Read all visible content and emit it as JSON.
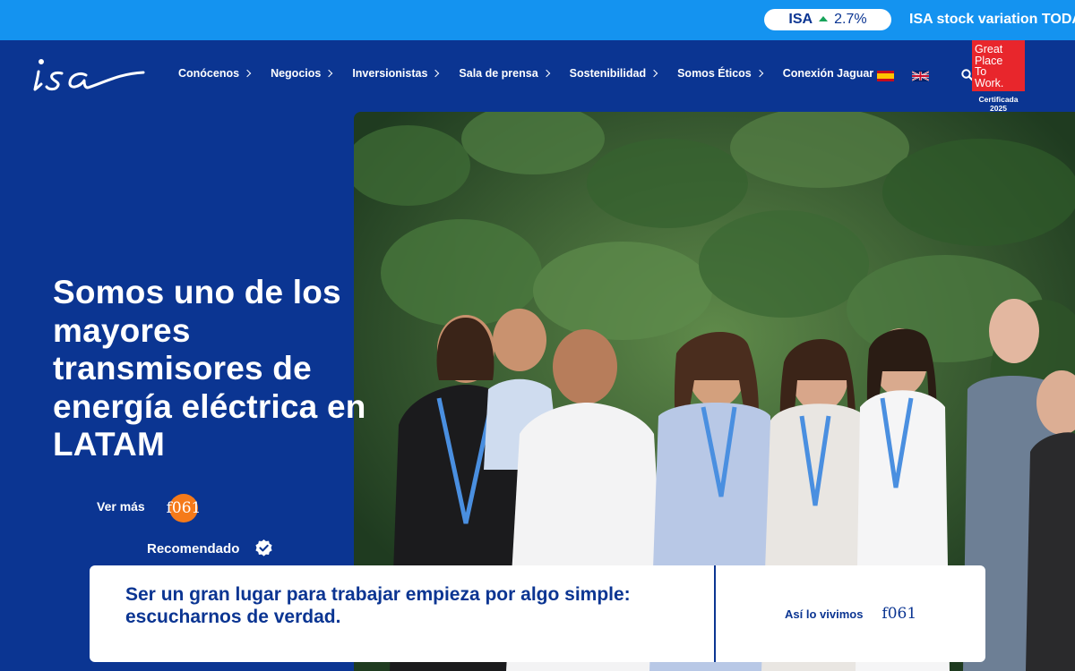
{
  "ticker": {
    "symbol": "ISA",
    "change": "2.7%",
    "headline": "ISA stock variation TODAY"
  },
  "header": {
    "logo_text": "isa",
    "nav": [
      {
        "label": "Conócenos"
      },
      {
        "label": "Negocios"
      },
      {
        "label": "Inversionistas"
      },
      {
        "label": "Sala de prensa"
      },
      {
        "label": "Sostenibilidad"
      },
      {
        "label": "Somos Éticos"
      },
      {
        "label": "Conexión Jaguar"
      }
    ],
    "badge": {
      "lines": [
        "Great",
        "Place",
        "To",
        "Work."
      ],
      "certified": "Certificada",
      "year": "2025"
    }
  },
  "hero": {
    "headline": "Somos uno de los mayores transmisores de energía eléctrica en LATAM",
    "cta_label": "Ver más",
    "cta_icon_glyph": "f061",
    "recommended_label": "Recomendado"
  },
  "card": {
    "text": "Ser un gran lugar para trabajar empieza por algo simple: escucharnos de verdad.",
    "cta_label": "Así lo vivimos",
    "cta_icon_glyph": "f061"
  },
  "colors": {
    "brand_blue": "#0b3592",
    "ticker_blue": "#1493f0",
    "accent_orange": "#f57a1a",
    "gptw_red": "#e8262c"
  }
}
